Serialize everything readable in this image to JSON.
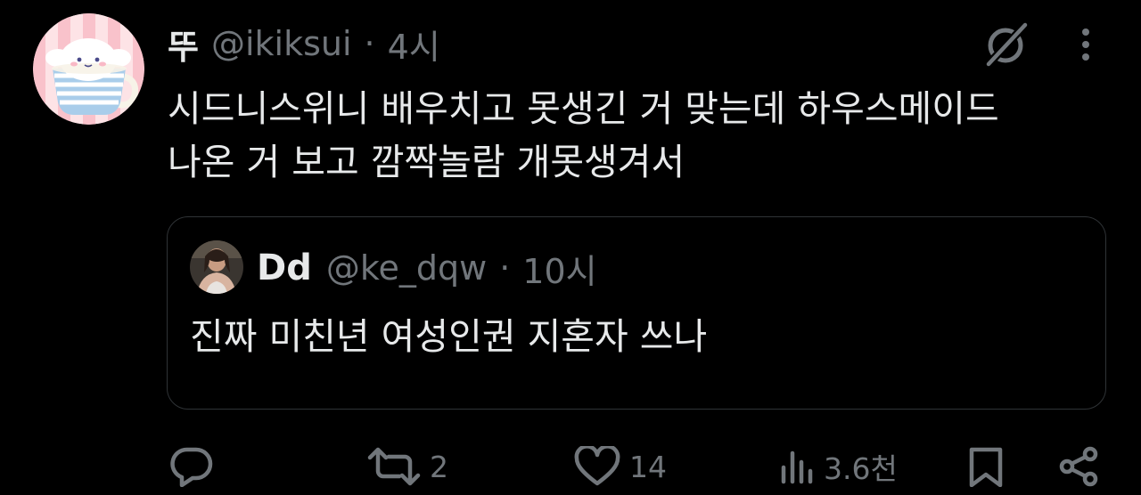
{
  "tweet": {
    "display_name": "뚜",
    "handle": "@ikiksui",
    "separator": "·",
    "time": "4시",
    "text_line1": "시드니스위니 배우치고 못생긴 거 맞는데 하우스메이드",
    "text_line2": "나온 거 보고 깜짝놀람 개못생겨서",
    "avatar_icon": "cinnamoroll-teacup-avatar"
  },
  "quote": {
    "display_name": "Dd",
    "handle": "@ke_dqw",
    "separator": "·",
    "time": "10시",
    "text": "진짜 미친년 여성인권 지혼자 쓰나",
    "avatar_icon": "person-photo-avatar"
  },
  "actions": {
    "reply_icon": "reply-icon",
    "retweet_icon": "retweet-icon",
    "retweet_count": "2",
    "like_icon": "heart-icon",
    "like_count": "14",
    "views_icon": "views-icon",
    "views_count": "3.6천",
    "bookmark_icon": "bookmark-icon",
    "share_icon": "share-icon"
  },
  "colors": {
    "background": "#000000",
    "primary_text": "#e7e9ea",
    "secondary_text": "#71767b",
    "border": "#2f3336"
  }
}
